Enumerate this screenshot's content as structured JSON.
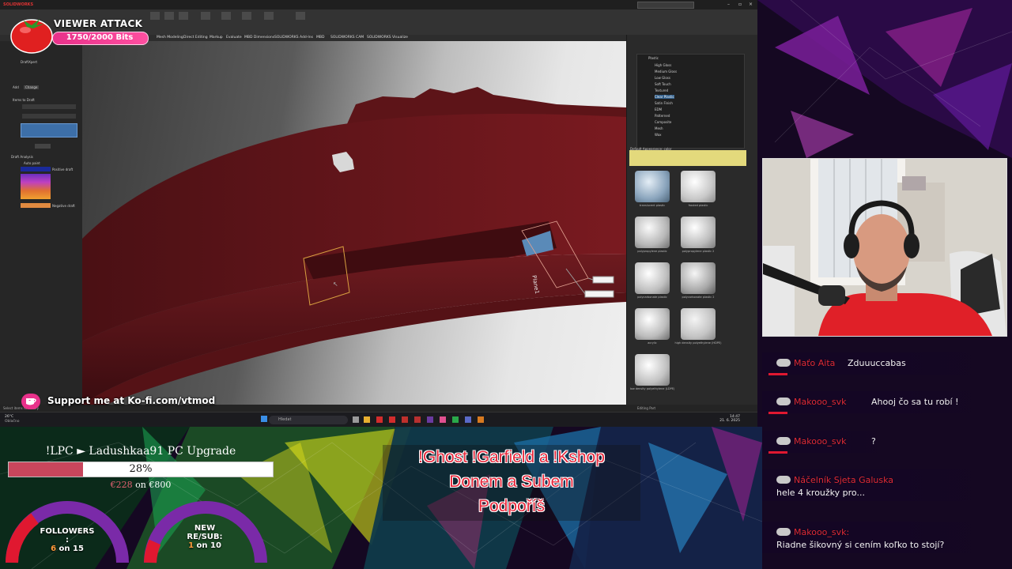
{
  "colors": {
    "accent_pink": "#e8318a",
    "chat_username_red": "#e02b3a",
    "goal_fill": "#c8465c",
    "command_red": "#e8283c",
    "gauge_red": "#e01830",
    "gauge_purple": "#7a2aa8",
    "part_color": "#6d1a1f"
  },
  "solidworks": {
    "app_name": "SOLIDWORKS",
    "tabs": [
      "Mesh Modeling",
      "Direct Editing",
      "Markup",
      "Evaluate",
      "MBD Dimensions",
      "SOLIDWORKS Add-Ins",
      "MBD",
      "SOLIDWORKS CAM",
      "SOLIDWORKS Visualize"
    ],
    "left_panel": {
      "title": "DraftXpert",
      "add_tab": "Add",
      "change_tab": "Change",
      "items_to_draft": "Items to Draft",
      "draft_analysis": "Draft Analysis",
      "auto_paint": "Auto paint",
      "positive_draft": "Positive draft",
      "negative_draft": "Negative draft"
    },
    "plane_label": "Plane1",
    "appearance_tree": [
      "Plastic",
      "High Gloss",
      "Medium Gloss",
      "Low Gloss",
      "Soft Touch",
      "Textured",
      "Clear Plastic",
      "Satin Finish",
      "EDM",
      "Patterned",
      "Composite",
      "Mesh",
      "Wax"
    ],
    "appearance_selected": "Clear Plastic",
    "default_appearance": "Default Appearance: color",
    "materials": [
      {
        "name": "translucent plastic",
        "icon": "material-sphere-icon"
      },
      {
        "name": "frosted plastic",
        "icon": "material-sphere-icon"
      },
      {
        "name": "polypropylene plastic",
        "icon": "material-sphere-icon"
      },
      {
        "name": "polypropylene plastic 2",
        "icon": "material-sphere-icon"
      },
      {
        "name": "polycarbonate plastic",
        "icon": "material-sphere-icon"
      },
      {
        "name": "polycarbonate plastic 2",
        "icon": "material-sphere-icon"
      },
      {
        "name": "acrylic",
        "icon": "material-sphere-icon"
      },
      {
        "name": "high density polyethylene (HDPE)",
        "icon": "material-sphere-icon"
      },
      {
        "name": "low density polyethylene (LDPE)",
        "icon": "material-sphere-icon"
      }
    ],
    "status_left": "Select items to modify",
    "status_right": "Editing Part",
    "taskbar_search": "Hledat",
    "clock_time": "14:47",
    "clock_date": "21. 6. 2025",
    "weather_temp": "26°C",
    "weather_text": "Oblačno"
  },
  "alert": {
    "title": "VIEWER ATTACK",
    "bits": "1750/2000 Bits",
    "progress": 0.875
  },
  "kofi": {
    "text": "Support me at Ko-fi.com/vtmod"
  },
  "goal": {
    "title": "!LPC ► Ladushkaa91 PC Upgrade",
    "percent_label": "28%",
    "progress": 0.28,
    "raised": "€228",
    "on": "on",
    "target": "€800"
  },
  "gauges": {
    "followers": {
      "label": "FOLLOWERS",
      "sep": ":",
      "current": "6",
      "on": "on",
      "target": "15"
    },
    "subs": {
      "label_line1": "NEW",
      "label_line2": "RE/SUB:",
      "current": "1",
      "on": "on",
      "target": "10"
    }
  },
  "commands": [
    "!Ghost  !Garfield a !Kshop",
    "Donem a Subem",
    "Podpoříš"
  ],
  "chat": [
    {
      "user": "Maťo Aita",
      "text": "Zduuuccabas"
    },
    {
      "user": "Makooo_svk",
      "text": "Ahooj čo sa tu robí !"
    },
    {
      "user": "Makooo_svk",
      "text": "?"
    },
    {
      "user": "Náčelník Sjeta Galuska",
      "text": "hele 4 kroužky pro..."
    },
    {
      "user": "Makooo_svk:",
      "text": "Riadne šikovný si cením koľko to stojí?"
    }
  ]
}
